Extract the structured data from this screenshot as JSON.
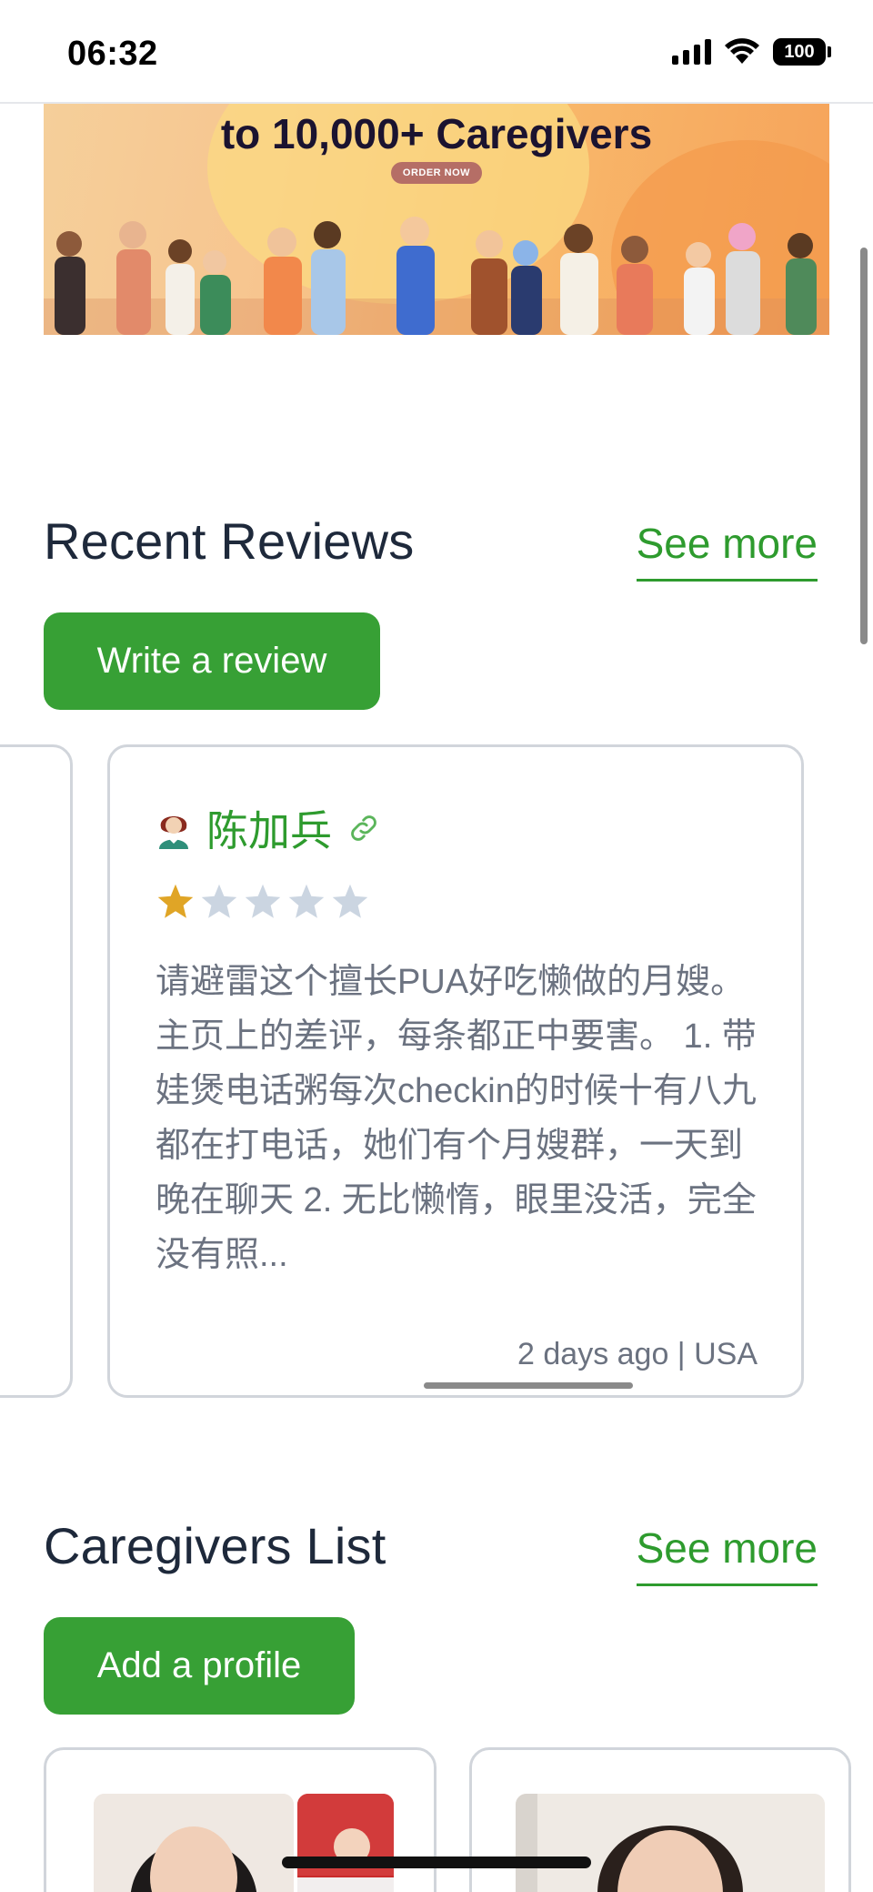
{
  "status_bar": {
    "time": "06:32",
    "battery": "100"
  },
  "banner": {
    "title": "to 10,000+ Caregivers",
    "button_label": "ORDER NOW"
  },
  "reviews_section": {
    "title": "Recent Reviews",
    "see_more": "See more",
    "write_button": "Write a review"
  },
  "review": {
    "reviewer_name": "陈加兵",
    "rating": 1,
    "max_rating": 5,
    "text": "请避雷这个擅长PUA好吃懒做的月嫂。主页上的差评，每条都正中要害。 1. 带娃煲电话粥每次checkin的时候十有八九都在打电话，她们有个月嫂群，一天到晚在聊天 2. 无比懒惰，眼里没活，完全没有照...",
    "meta": "2 days ago | USA",
    "star_color": "#e0a526",
    "star_empty_color": "#cbd5e1"
  },
  "caregivers_section": {
    "title": "Caregivers List",
    "see_more": "See more",
    "add_button": "Add a profile"
  },
  "colors": {
    "accent_green": "#37a035",
    "link_green": "#2e9b2e"
  },
  "icons": [
    "signal-icon",
    "wifi-icon",
    "battery-icon",
    "avatar-icon",
    "link-icon",
    "star-icon"
  ]
}
